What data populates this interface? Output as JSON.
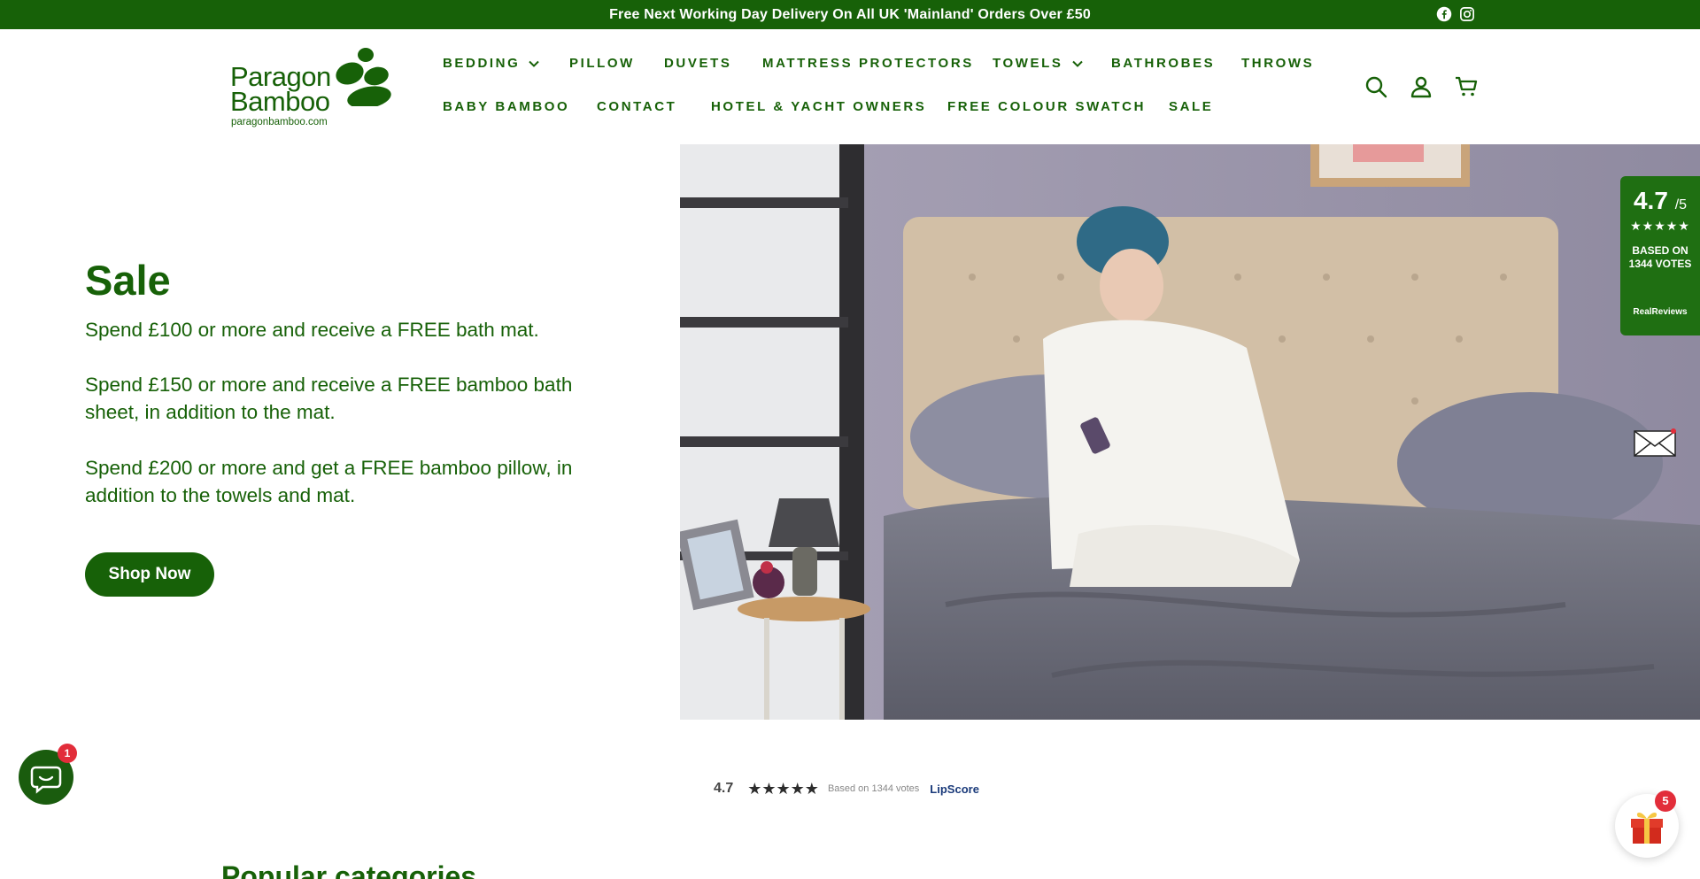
{
  "announcement": {
    "text": "Free Next Working Day Delivery On All UK 'Mainland' Orders Over £50",
    "social": [
      "facebook-icon",
      "instagram-icon"
    ]
  },
  "logo": {
    "line1": "Paragon",
    "line2": "Bamboo",
    "url": "paragonbamboo.com"
  },
  "nav": {
    "row1": [
      {
        "label": "BEDDING",
        "dropdown": true
      },
      {
        "label": "PILLOW",
        "dropdown": false
      },
      {
        "label": "DUVETS",
        "dropdown": false
      },
      {
        "label": "MATTRESS PROTECTORS",
        "dropdown": false
      },
      {
        "label": "TOWELS",
        "dropdown": true
      },
      {
        "label": "BATHROBES",
        "dropdown": false
      },
      {
        "label": "THROWS",
        "dropdown": false
      }
    ],
    "row2": [
      {
        "label": "BABY BAMBOO",
        "dropdown": false
      },
      {
        "label": "CONTACT",
        "dropdown": false
      },
      {
        "label": "HOTEL & YACHT OWNERS",
        "dropdown": false
      },
      {
        "label": "FREE COLOUR SWATCH",
        "dropdown": false
      },
      {
        "label": "SALE",
        "dropdown": false
      }
    ]
  },
  "header_icons": [
    "search-icon",
    "account-icon",
    "cart-icon"
  ],
  "hero": {
    "title": "Sale",
    "p1": "Spend £100 or more and receive a FREE bath mat.",
    "p2": "Spend £150 or more and receive a FREE bamboo bath sheet, in addition to the mat.",
    "p3": "Spend £200 or more and get a FREE bamboo pillow, in addition to the towels and mat.",
    "button": "Shop Now"
  },
  "reviews_widget": {
    "score": "4.7",
    "out_of": "/5",
    "stars": "★★★★★",
    "based_on": "BASED ON 1344 VOTES",
    "brand": "RealReviews"
  },
  "lipscore": {
    "score": "4.7",
    "stars": "★★★★★",
    "votes": "Based on 1344 votes",
    "brand": "LipScore"
  },
  "section": {
    "popular": "Popular categories"
  },
  "chat": {
    "badge": "1"
  },
  "gift": {
    "badge": "5"
  },
  "colors": {
    "brand_green": "#176108",
    "badge_red": "#e22d3a"
  }
}
